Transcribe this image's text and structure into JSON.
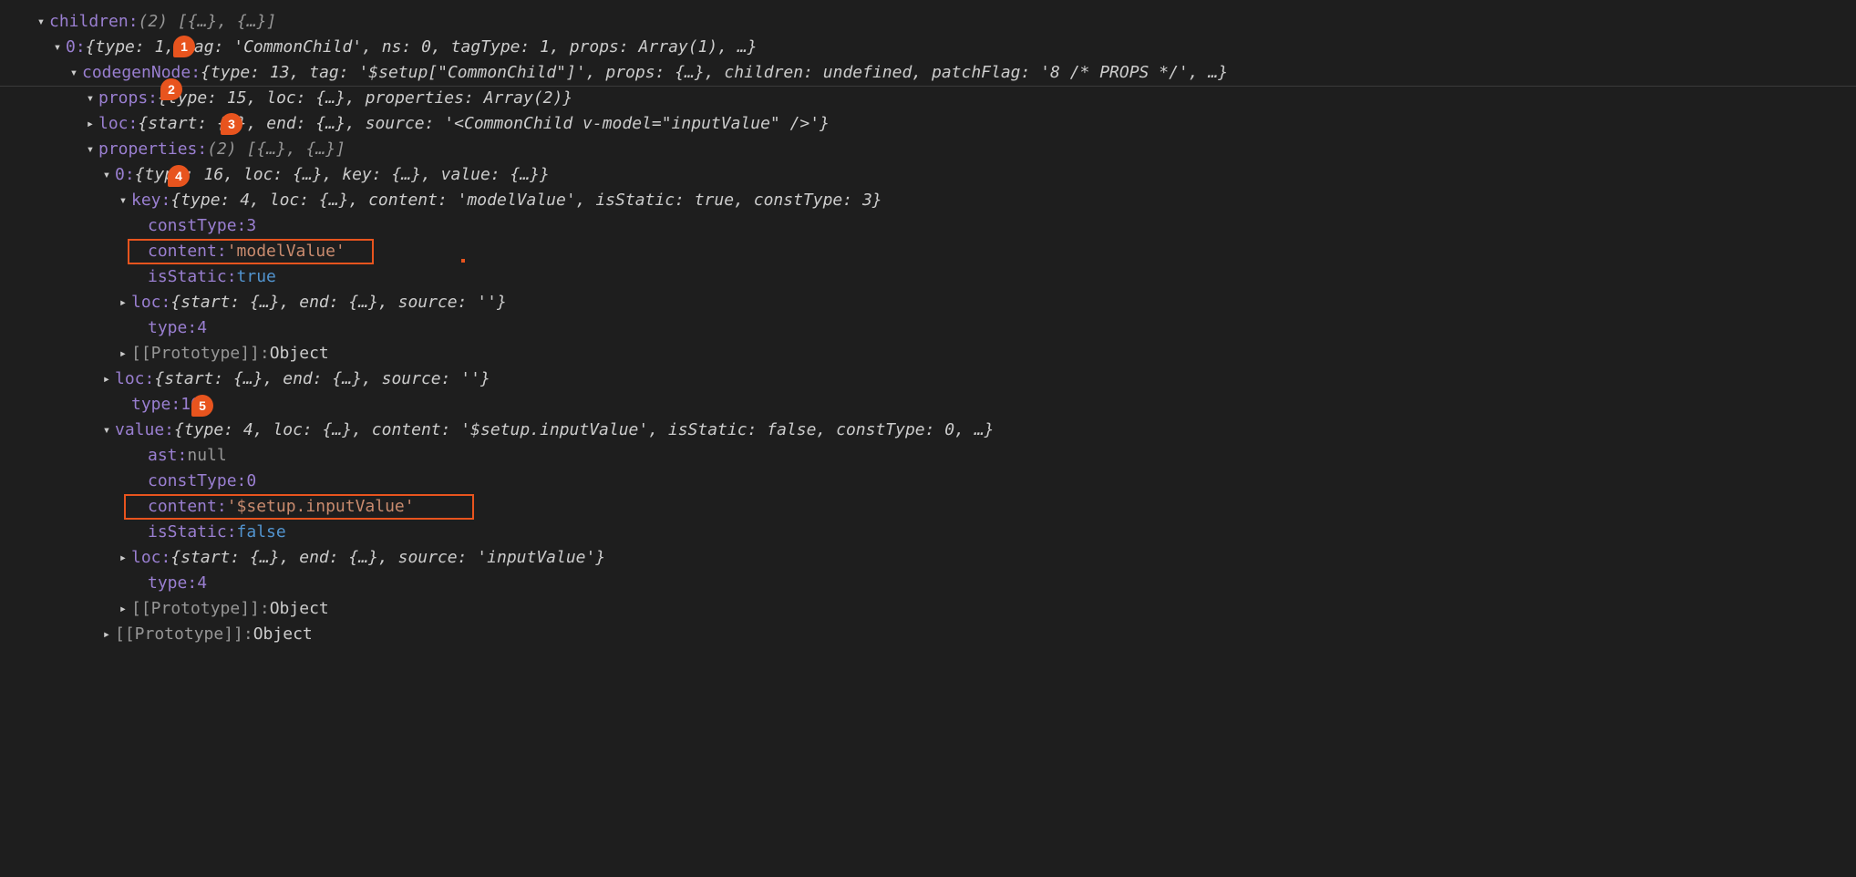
{
  "badges": {
    "b1": "1",
    "b2": "2",
    "b3": "3",
    "b4": "4",
    "b5": "5"
  },
  "carets": {
    "down": "▾",
    "right": "▸"
  },
  "tree": {
    "l0": {
      "key": "children: ",
      "summary": "(2) [{…}, {…}]"
    },
    "l1": {
      "key": "0: ",
      "summary": "{type: 1, tag: 'CommonChild', ns: 0, tagType: 1, props: Array(1), …}"
    },
    "l2": {
      "key": "codegenNode: ",
      "summary": "{type: 13, tag: '$setup[\"CommonChild\"]', props: {…}, children: undefined, patchFlag: '8 /* PROPS */', …}"
    },
    "l3": {
      "key": "props: ",
      "summary": "{type: 15, loc: {…}, properties: Array(2)}"
    },
    "l4": {
      "key": "loc: ",
      "summary": "{start: {…}, end: {…}, source: '<CommonChild v-model=\"inputValue\" />'}"
    },
    "l5": {
      "key": "properties: ",
      "summary": "(2) [{…}, {…}]"
    },
    "l6": {
      "key": "0: ",
      "summary": "{type: 16, loc: {…}, key: {…}, value: {…}}"
    },
    "l7": {
      "key": "key: ",
      "summary": "{type: 4, loc: {…}, content: 'modelValue', isStatic: true, constType: 3}"
    },
    "l8": {
      "key": "constType: ",
      "val": "3"
    },
    "l9": {
      "key": "content: ",
      "val": "'modelValue'"
    },
    "l10": {
      "key": "isStatic: ",
      "val": "true"
    },
    "l11": {
      "key": "loc: ",
      "summary": "{start: {…}, end: {…}, source: ''}"
    },
    "l12": {
      "key": "type: ",
      "val": "4"
    },
    "l13": {
      "key": "[[Prototype]]: ",
      "val": "Object"
    },
    "l14": {
      "key": "loc: ",
      "summary": "{start: {…}, end: {…}, source: ''}"
    },
    "l15": {
      "key": "type: ",
      "val": "16"
    },
    "l16": {
      "key": "value: ",
      "summary": "{type: 4, loc: {…}, content: '$setup.inputValue', isStatic: false, constType: 0, …}"
    },
    "l17": {
      "key": "ast: ",
      "val": "null"
    },
    "l18": {
      "key": "constType: ",
      "val": "0"
    },
    "l19": {
      "key": "content: ",
      "val": "'$setup.inputValue'"
    },
    "l20": {
      "key": "isStatic: ",
      "val": "false"
    },
    "l21": {
      "key": "loc: ",
      "summary": "{start: {…}, end: {…}, source: 'inputValue'}"
    },
    "l22": {
      "key": "type: ",
      "val": "4"
    },
    "l23": {
      "key": "[[Prototype]]: ",
      "val": "Object"
    },
    "l24": {
      "key": "[[Prototype]]: ",
      "val": "Object"
    }
  }
}
